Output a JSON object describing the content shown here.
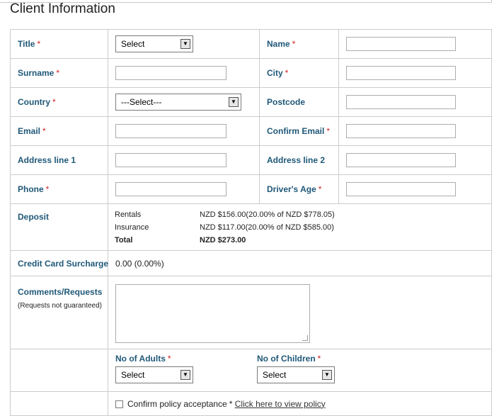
{
  "page": {
    "title": "Client Information"
  },
  "form": {
    "title": {
      "label": "Title",
      "value": "Select"
    },
    "name": {
      "label": "Name"
    },
    "surname": {
      "label": "Surname"
    },
    "city": {
      "label": "City"
    },
    "country": {
      "label": "Country",
      "value": "---Select---"
    },
    "postcode": {
      "label": "Postcode"
    },
    "email": {
      "label": "Email"
    },
    "confirm_email": {
      "label": "Confirm Email"
    },
    "address1": {
      "label": "Address line 1"
    },
    "address2": {
      "label": "Address line 2"
    },
    "phone": {
      "label": "Phone"
    },
    "drivers_age": {
      "label": "Driver's Age"
    },
    "required_mark": "*"
  },
  "deposit": {
    "label": "Deposit",
    "rows": [
      {
        "name": "Rentals",
        "value": "NZD $156.00(20.00% of NZD $778.05)"
      },
      {
        "name": "Insurance",
        "value": "NZD $117.00(20.00% of NZD $585.00)"
      },
      {
        "name": "Total",
        "value": "NZD $273.00"
      }
    ]
  },
  "surcharge": {
    "label": "Credit Card Surcharge",
    "value": "0.00  (0.00%)"
  },
  "comments": {
    "label": "Comments/Requests",
    "note": "(Requests not guaranteed)"
  },
  "occupants": {
    "adults_label": "No of Adults",
    "adults_value": "Select",
    "children_label": "No of Children",
    "children_value": "Select"
  },
  "policy": {
    "label": "Confirm policy acceptance",
    "link": "Click here to view policy"
  }
}
